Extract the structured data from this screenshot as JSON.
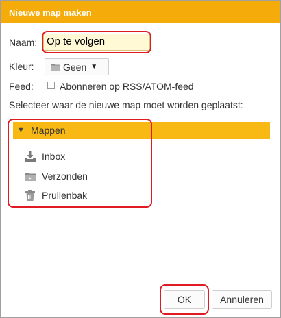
{
  "dialog": {
    "title": "Nieuwe map maken",
    "name_label": "Naam:",
    "name_value": "Op te volgen",
    "color_label": "Kleur:",
    "color_value": "Geen",
    "feed_label": "Feed:",
    "feed_checkbox_label": "Abonneren op RSS/ATOM-feed",
    "location_label": "Selecteer waar de nieuwe map moet worden geplaatst:",
    "tree": {
      "root_label": "Mappen",
      "items": [
        {
          "label": "Inbox",
          "icon": "inbox-download-icon"
        },
        {
          "label": "Verzonden",
          "icon": "sent-folder-icon"
        },
        {
          "label": "Prullenbak",
          "icon": "trash-icon"
        }
      ]
    },
    "buttons": {
      "ok": "OK",
      "cancel": "Annuleren"
    }
  },
  "colors": {
    "title_bar": "#f5ac0a",
    "tree_selected": "#f9b915",
    "input_bg": "#fff9d6",
    "highlight": "#e01b24"
  }
}
